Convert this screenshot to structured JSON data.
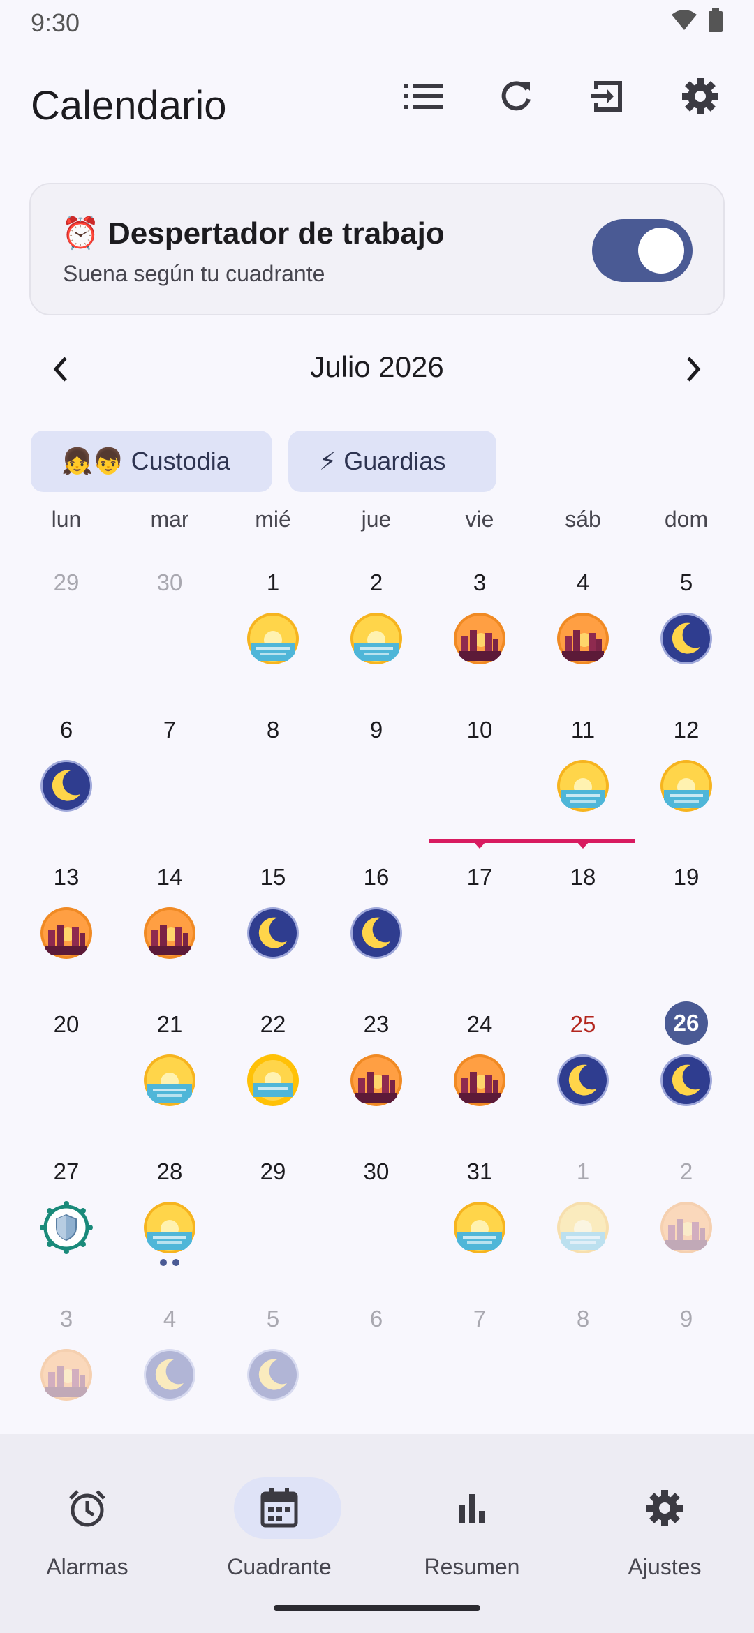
{
  "status_bar": {
    "time": "9:30"
  },
  "app_bar": {
    "title": "Calendario"
  },
  "alarm_card": {
    "title": "⏰ Despertador de trabajo",
    "subtitle": "Suena según tu cuadrante",
    "enabled": true
  },
  "month": {
    "title": "Julio 2026"
  },
  "chips": [
    {
      "label": "👧👦 Custodia"
    },
    {
      "label": "⚡ Guardias"
    }
  ],
  "weekdays": [
    "lun",
    "mar",
    "mié",
    "jue",
    "vie",
    "sáb",
    "dom"
  ],
  "weeks": [
    [
      {
        "day": "29",
        "muted": true,
        "shift": null
      },
      {
        "day": "30",
        "muted": true,
        "shift": null
      },
      {
        "day": "1",
        "shift": "sunrise"
      },
      {
        "day": "2",
        "shift": "sunrise"
      },
      {
        "day": "3",
        "shift": "city-sunset"
      },
      {
        "day": "4",
        "shift": "city-sunset"
      },
      {
        "day": "5",
        "shift": "moon"
      }
    ],
    [
      {
        "day": "6",
        "shift": "moon"
      },
      {
        "day": "7",
        "shift": null
      },
      {
        "day": "8",
        "shift": null
      },
      {
        "day": "9",
        "shift": null
      },
      {
        "day": "10",
        "shift": null
      },
      {
        "day": "11",
        "shift": "sunrise"
      },
      {
        "day": "12",
        "shift": "sunrise"
      }
    ],
    [
      {
        "day": "13",
        "shift": "city-sunset"
      },
      {
        "day": "14",
        "shift": "city-sunset"
      },
      {
        "day": "15",
        "shift": "moon"
      },
      {
        "day": "16",
        "shift": "moon"
      },
      {
        "day": "17",
        "shift": null
      },
      {
        "day": "18",
        "shift": null
      },
      {
        "day": "19",
        "shift": null
      }
    ],
    [
      {
        "day": "20",
        "shift": null
      },
      {
        "day": "21",
        "shift": "sunrise"
      },
      {
        "day": "22",
        "shift": "sunrise-rays"
      },
      {
        "day": "23",
        "shift": "city-sunset"
      },
      {
        "day": "24",
        "shift": "city-sunset"
      },
      {
        "day": "25",
        "shift": "moon",
        "holiday": true
      },
      {
        "day": "26",
        "shift": "moon",
        "today": true
      }
    ],
    [
      {
        "day": "27",
        "shift": "shield"
      },
      {
        "day": "28",
        "shift": "sunrise",
        "dots": 2
      },
      {
        "day": "29",
        "shift": null
      },
      {
        "day": "30",
        "shift": null
      },
      {
        "day": "31",
        "shift": "sunrise"
      },
      {
        "day": "1",
        "muted": true,
        "shift": "sunrise"
      },
      {
        "day": "2",
        "muted": true,
        "shift": "city-sunset"
      }
    ],
    [
      {
        "day": "3",
        "muted": true,
        "shift": "city-sunset"
      },
      {
        "day": "4",
        "muted": true,
        "shift": "moon"
      },
      {
        "day": "5",
        "muted": true,
        "shift": "moon"
      },
      {
        "day": "6",
        "muted": true,
        "shift": null
      },
      {
        "day": "7",
        "muted": true,
        "shift": null
      },
      {
        "day": "8",
        "muted": true,
        "shift": null
      },
      {
        "day": "9",
        "muted": true,
        "shift": null
      }
    ]
  ],
  "bottom_nav": [
    {
      "label": "Alarmas",
      "icon": "alarm-icon",
      "active": false
    },
    {
      "label": "Cuadrante",
      "icon": "calendar-icon",
      "active": true
    },
    {
      "label": "Resumen",
      "icon": "bar-chart-icon",
      "active": false
    },
    {
      "label": "Ajustes",
      "icon": "gear-icon",
      "active": false
    }
  ],
  "colors": {
    "primary": "#4a5a94",
    "chip_bg": "#dfe3f7",
    "guard_line": "#d81b60",
    "holiday_text": "#b3261e",
    "shield_ring": "#1a8a7a"
  }
}
